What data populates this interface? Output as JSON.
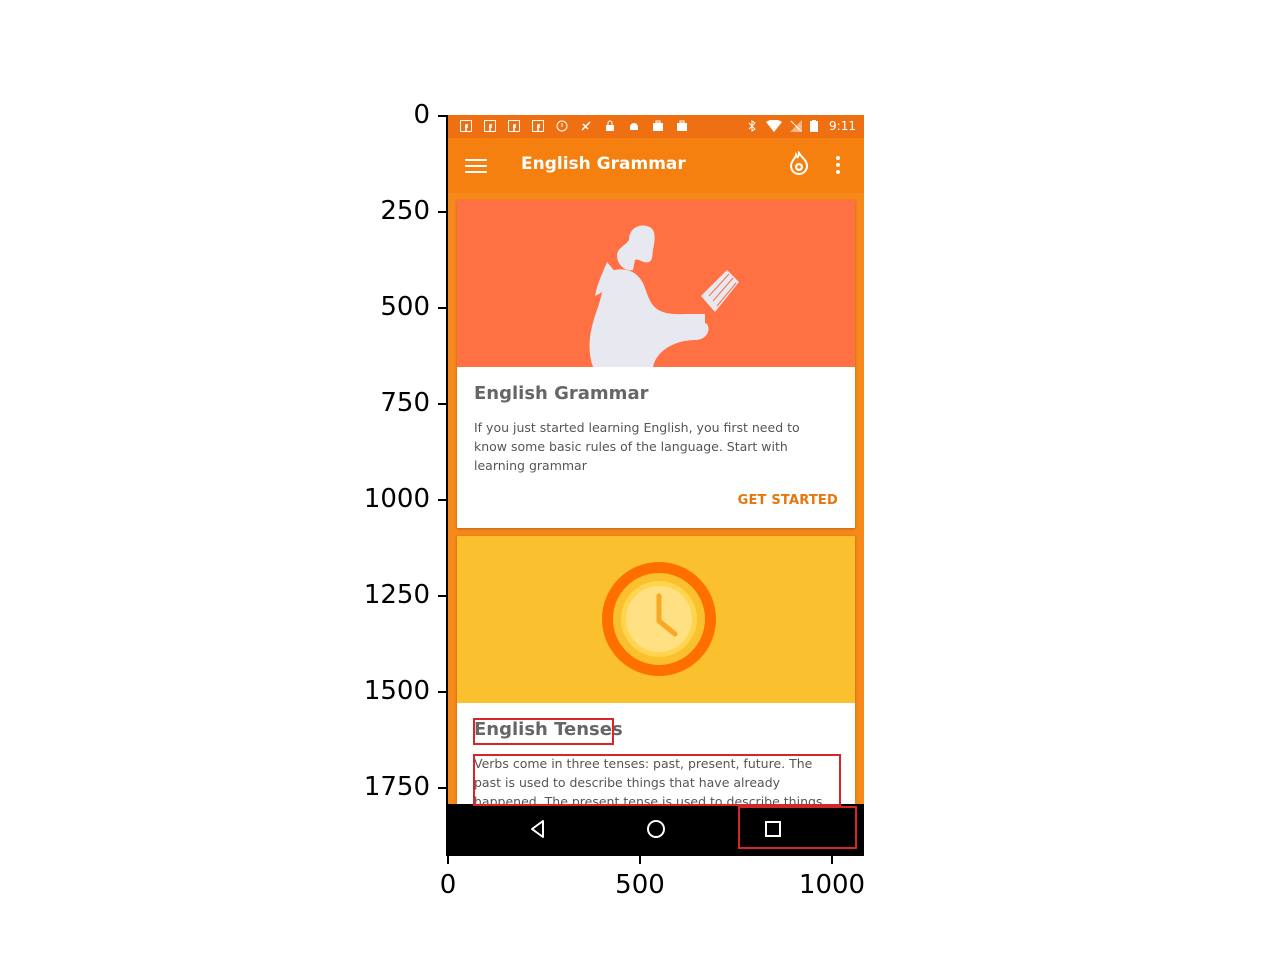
{
  "axes": {
    "y_ticks": [
      "0",
      "250",
      "500",
      "750",
      "1000",
      "1250",
      "1500",
      "1750"
    ],
    "x_ticks": [
      "0",
      "500",
      "1000"
    ]
  },
  "status_bar": {
    "time": "9:11",
    "left_icons": [
      "facebook-icon",
      "facebook-icon",
      "facebook-icon",
      "facebook-icon",
      "info-icon",
      "no-location-icon",
      "lock-icon",
      "android-icon",
      "briefcase-icon",
      "briefcase-icon"
    ],
    "right_icons": [
      "bluetooth-icon",
      "wifi-icon",
      "no-signal-icon",
      "battery-icon"
    ]
  },
  "app_bar": {
    "title": "English Grammar",
    "background": "#f57f0f"
  },
  "cards": [
    {
      "title": "English Grammar",
      "description": "If you just started learning English, you first need to know some basic rules of the language. Start with learning grammar",
      "action": "GET STARTED",
      "hero_color": "#ff7043",
      "hero_icon": "reading-woman-illustration"
    },
    {
      "title": "English Tenses",
      "description": "Verbs come in three tenses: past, present, future. The past is used to describe things that have already happened. The present tense is used to describe things that are happening",
      "hero_color": "#fbc02d",
      "hero_icon": "clock-illustration"
    }
  ],
  "nav_bar": {
    "buttons": [
      "back-icon",
      "home-icon",
      "recents-icon"
    ]
  },
  "colors": {
    "accent": "#e8750e",
    "highlight_box": "#d62728",
    "status_bar": "#ee7012"
  }
}
